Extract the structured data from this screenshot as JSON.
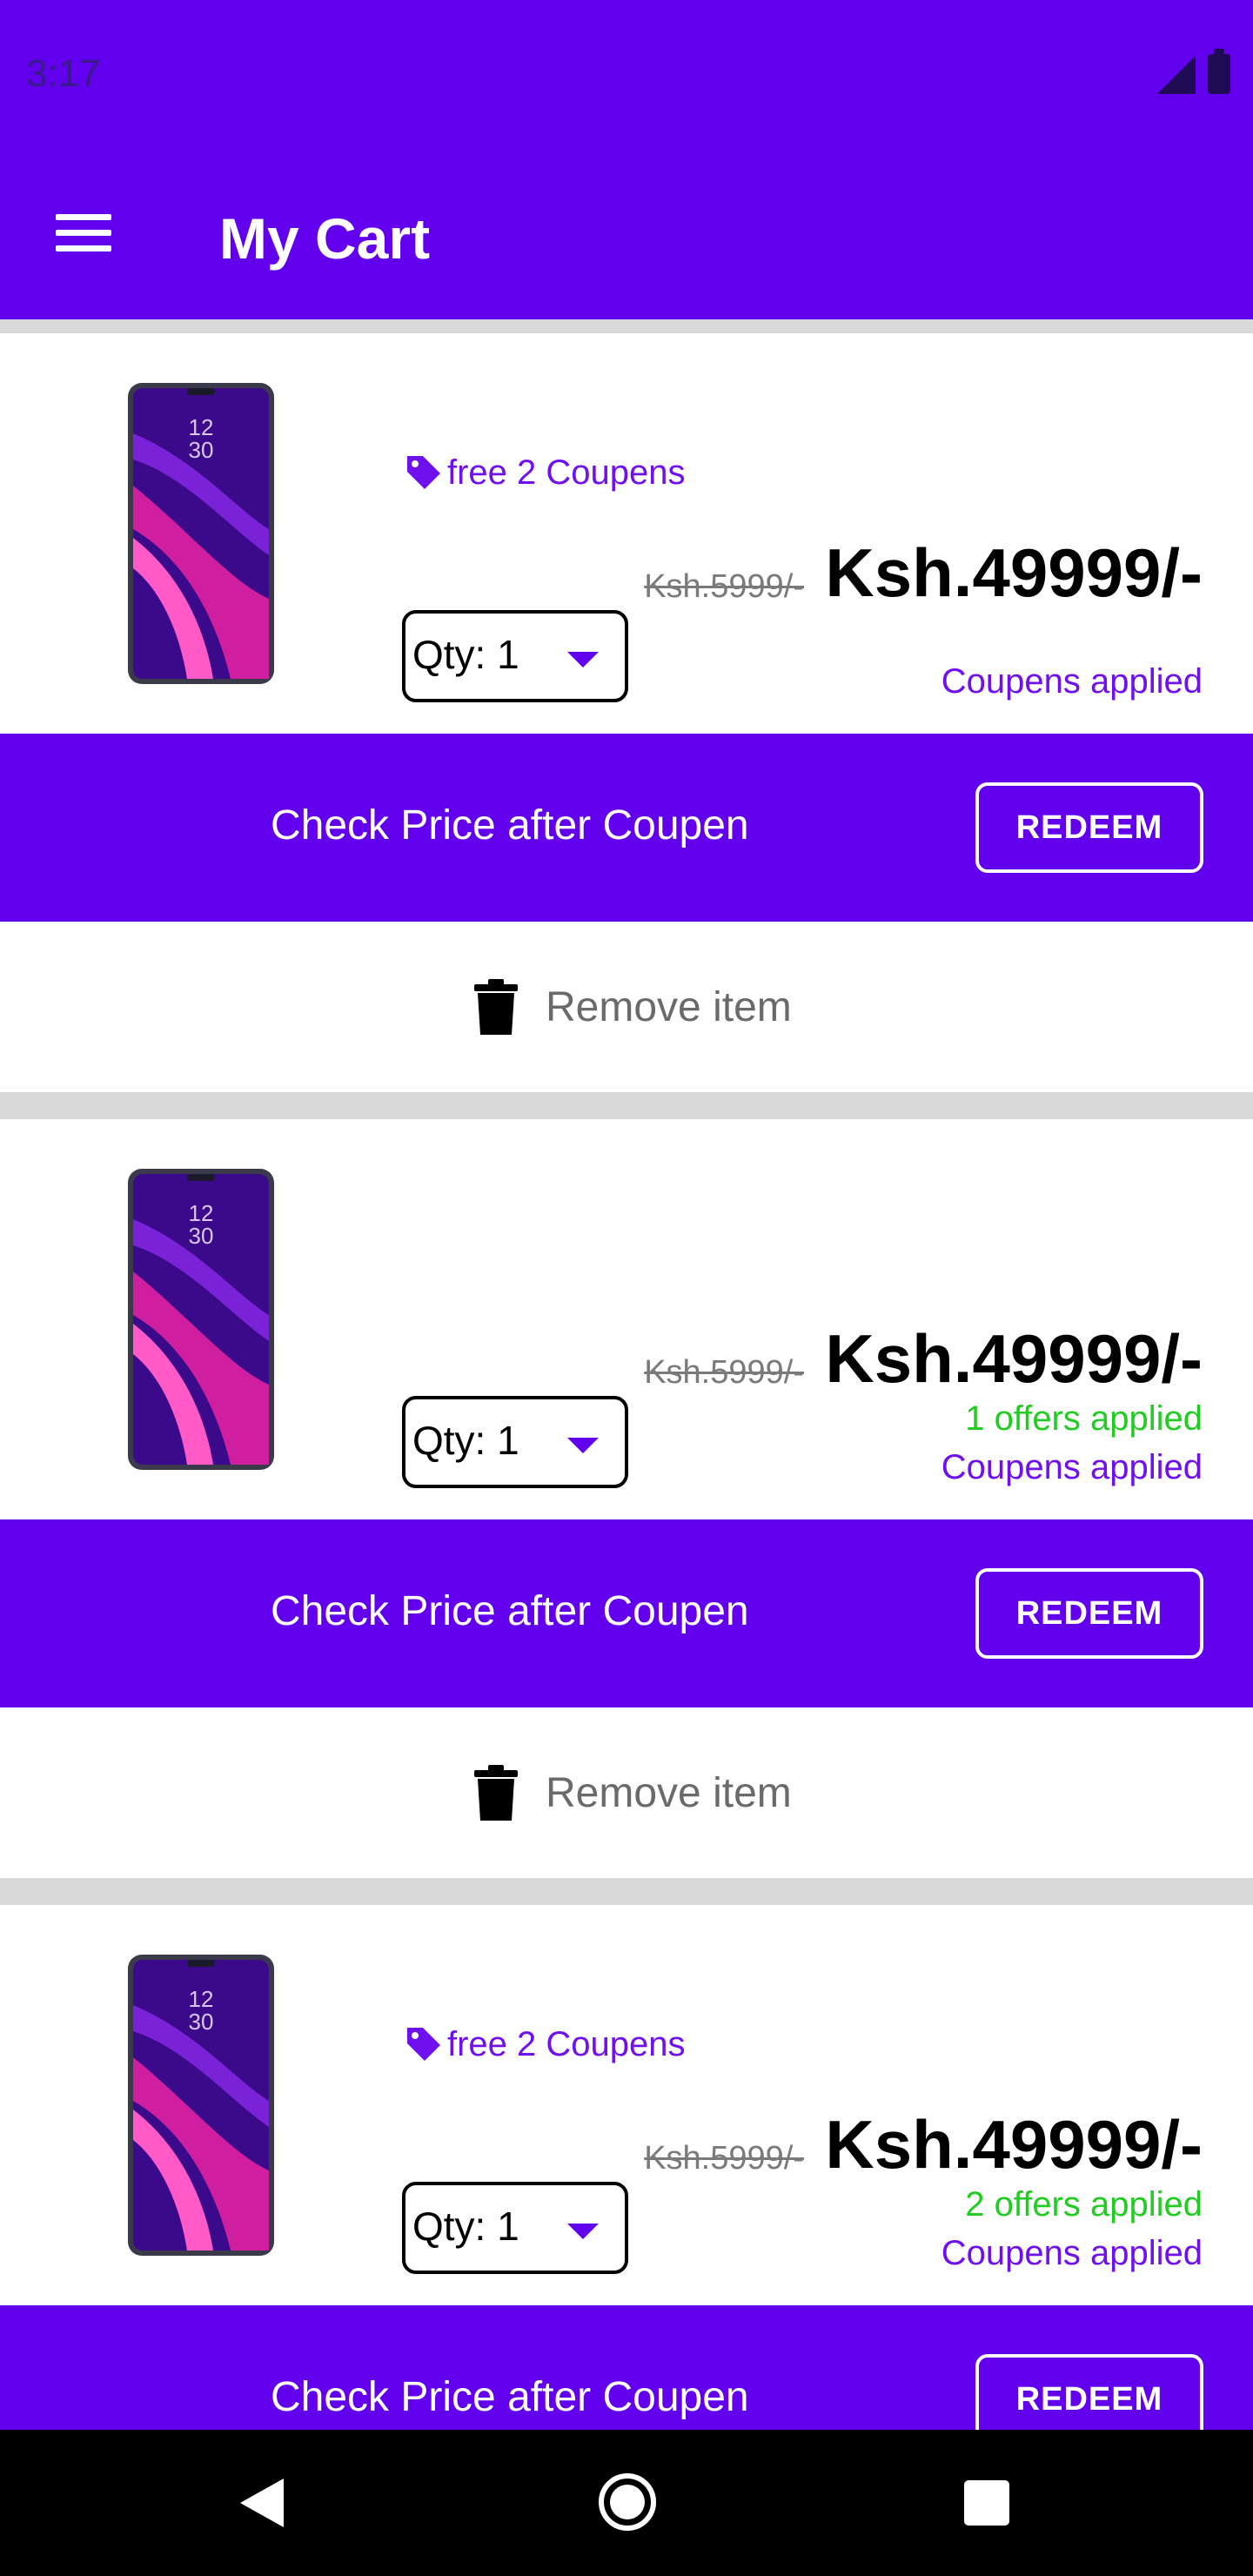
{
  "status_bar": {
    "time": "3:17"
  },
  "app_bar": {
    "title": "My Cart"
  },
  "items": [
    {
      "coupon_tag": "free 2 Coupens",
      "cut_price": "Ksh.5999/-",
      "price": "Ksh.49999/-",
      "offers": "",
      "coupens_applied": "Coupens applied",
      "qty_label": "Qty: 1",
      "redeem_text": "Check Price after Coupen",
      "redeem_button": "REDEEM",
      "remove_label": "Remove item"
    },
    {
      "coupon_tag": "",
      "cut_price": "Ksh.5999/-",
      "price": "Ksh.49999/-",
      "offers": "1 offers applied",
      "coupens_applied": "Coupens applied",
      "qty_label": "Qty: 1",
      "redeem_text": "Check Price after Coupen",
      "redeem_button": "REDEEM",
      "remove_label": "Remove item"
    },
    {
      "coupon_tag": "free 2 Coupens",
      "cut_price": "Ksh.5999/-",
      "price": "Ksh.49999/-",
      "offers": "2 offers applied",
      "coupens_applied": "Coupens applied",
      "qty_label": "Qty: 1",
      "redeem_text": "Check Price after Coupen",
      "redeem_button": "REDEEM",
      "remove_label": ""
    }
  ],
  "colors": {
    "primary": "#6200ee",
    "coupon_text": "#6f10ee",
    "offers_green": "#22cc22",
    "divider": "#d9d9d9"
  },
  "icons": {
    "menu": "menu-icon",
    "tag": "tag-icon",
    "trash": "trash-icon",
    "back": "back-icon",
    "home": "home-icon",
    "recent": "recent-apps-icon"
  }
}
